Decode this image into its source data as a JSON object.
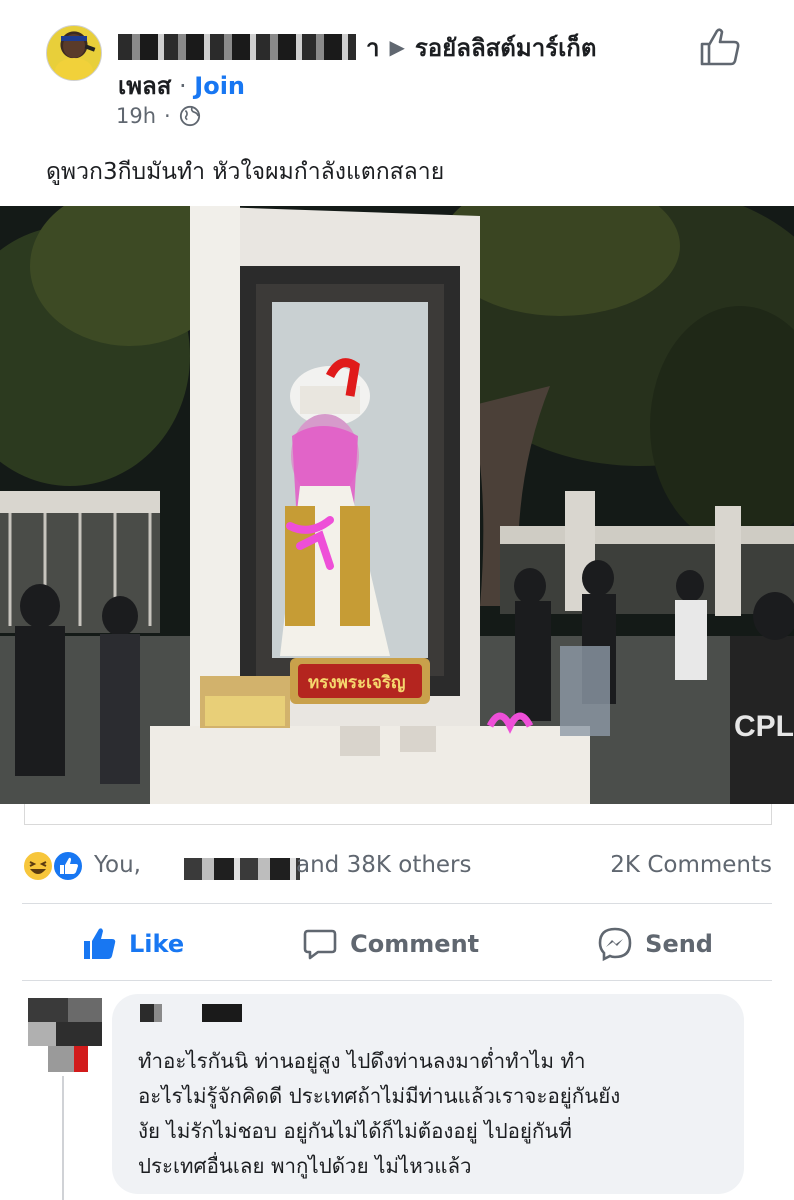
{
  "header": {
    "page_name": "รอยัลลิสต์มาร์เก็ตเพลส",
    "page_name_line1": "รอยัลลิสต์มาร์เก็ต",
    "page_name_line2": "เพลส",
    "separator": " · ",
    "join_label": "Join",
    "time": "19h",
    "privacy_icon": "globe-icon",
    "top_action_icon": "thumbs-up-outline-icon"
  },
  "post": {
    "text": "ดูพวก3กีบมันทำ หัวใจผมกำลังแตกสลาย",
    "image": {
      "description_icon": "photo",
      "frame_plaque_text": "ทรงพระเจริญ",
      "shirt_text": "CPL"
    }
  },
  "stats": {
    "reaction_icons": [
      "haha-icon",
      "like-icon"
    ],
    "you_label": "You,",
    "others_label": "and 38K others",
    "comments_label": "2K Comments"
  },
  "actions": {
    "like_label": "Like",
    "comment_label": "Comment",
    "send_label": "Send"
  },
  "comment": {
    "text": "ทำอะไรกันนิ ท่านอยู่สูง ไปดึงท่านลงมาต่ำทำไม ทำ\nอะไรไม่รู้จักคิดดี ประเทศถ้าไม่มีท่านแล้วเราจะอยู่กันยัง\nงัย ไม่รักไม่ชอบ อยู่กันไม่ได้ก็ไม่ต้องอยู่ ไปอยู่กันที่\nประเทศอื่นเลย พากูไปด้วย ไม่ไหวแล้ว"
  },
  "colors": {
    "accent": "#1877f2",
    "secondary_text": "#606770",
    "bubble_bg": "#f0f2f5",
    "graffiti_pink": "#e64fd2"
  }
}
